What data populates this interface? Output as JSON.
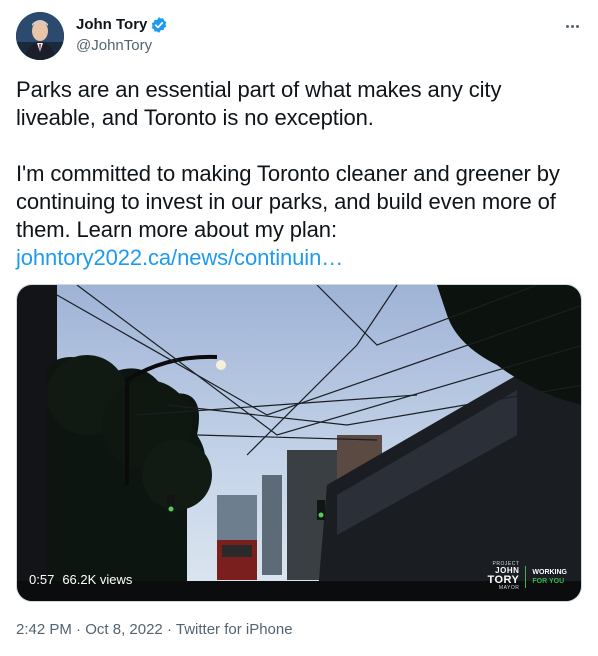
{
  "author": {
    "display_name": "John Tory",
    "handle": "@JohnTory",
    "verified": true
  },
  "icons": {
    "avatar": "avatar-photo",
    "verified": "verified-badge-icon",
    "more": "more-options-icon"
  },
  "tweet": {
    "paragraph1": "Parks are an essential part of what makes any city liveable, and Toronto is no exception.",
    "paragraph2": "I'm committed to making Toronto cleaner and greener by continuing to invest in our parks, and build even more of them. Learn more about my plan:",
    "link_text": "johntory2022.ca/news/continuin…"
  },
  "video": {
    "duration": "0:57",
    "views": "66.2K views",
    "brand_project": "PROJECT",
    "brand_name_line1": "JOHN",
    "brand_name_line2": "TORY",
    "brand_mayor": "MAYOR",
    "brand_tagline1": "WORKING",
    "brand_tagline2": "FOR YOU"
  },
  "meta": {
    "time": "2:42 PM",
    "separator1": "·",
    "date": "Oct 8, 2022",
    "separator2": "·",
    "source": "Twitter for iPhone"
  },
  "colors": {
    "link": "#1d9bf0",
    "verified": "#1d9bf0",
    "secondary_text": "#536471",
    "brand_green": "#3bb54a"
  }
}
